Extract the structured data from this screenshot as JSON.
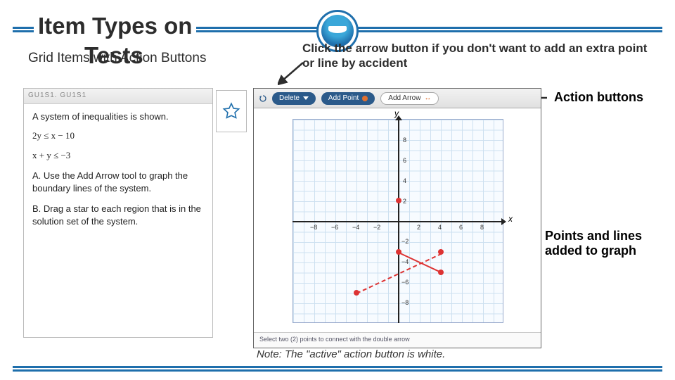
{
  "header": {
    "title": "Item Types on",
    "tests_overlap": "Tests",
    "subtitle": "Grid Items with Action Buttons"
  },
  "tip": "Click the arrow button if you don't want to add an extra point or line by accident",
  "annot_action": "Action buttons",
  "annot_points": "Points and lines added to graph",
  "note": "Note: The \"active\" action button is white.",
  "qpanel": {
    "hdr": "GU1S1. GU1S1",
    "stem": "A system of inequalities is shown.",
    "eq1": "2y ≤ x − 10",
    "eq2": "x + y ≤ −3",
    "optA": "A. Use the Add Arrow tool to graph the boundary lines of the system.",
    "optB": "B. Drag a star to each region that is in the solution set of the system."
  },
  "toolbar": {
    "delete": "Delete",
    "addpoint": "Add Point",
    "addarrow": "Add Arrow"
  },
  "graph": {
    "footer": "Select two (2) points to connect with the double arrow",
    "lbl_x": "x",
    "lbl_y": "y",
    "ticks_x_neg": [
      "−8",
      "−6",
      "−4",
      "−2"
    ],
    "ticks_x_pos": [
      "2",
      "4",
      "6",
      "8"
    ],
    "ticks_y_pos": [
      "2",
      "4",
      "6",
      "8"
    ],
    "ticks_y_neg": [
      "−2",
      "−4",
      "−6",
      "−8"
    ]
  },
  "chart_data": {
    "type": "scatter",
    "title": "",
    "xlabel": "x",
    "ylabel": "y",
    "xlim": [
      -10,
      10
    ],
    "ylim": [
      -10,
      10
    ],
    "x_ticks": [
      -8,
      -6,
      -4,
      -2,
      2,
      4,
      6,
      8
    ],
    "y_ticks": [
      -8,
      -6,
      -4,
      -2,
      2,
      4,
      6,
      8
    ],
    "series": [
      {
        "name": "points",
        "type": "scatter",
        "x": [
          0,
          -4,
          4,
          0,
          4
        ],
        "y": [
          2,
          -7,
          -3,
          -3,
          -5
        ]
      },
      {
        "name": "dashed-line",
        "type": "line",
        "style": "dashed",
        "x": [
          -4,
          4
        ],
        "y": [
          -7,
          -3
        ]
      },
      {
        "name": "short-line",
        "type": "line",
        "style": "solid",
        "x": [
          0,
          4
        ],
        "y": [
          -3,
          -5
        ]
      }
    ]
  }
}
